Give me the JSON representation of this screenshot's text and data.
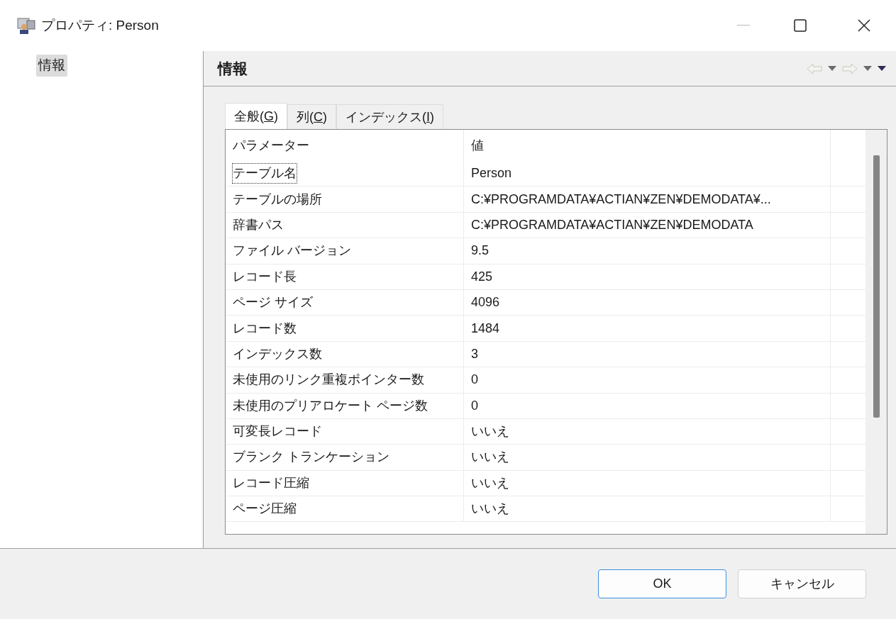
{
  "window": {
    "title": "プロパティ: Person"
  },
  "sidebar": {
    "items": [
      {
        "label": "情報",
        "selected": true
      }
    ]
  },
  "panel": {
    "title": "情報"
  },
  "tabs": [
    {
      "label": "全般(**G**)",
      "selected": true
    },
    {
      "label": "列(**C**)",
      "selected": false
    },
    {
      "label": "インデックス(**I**)",
      "selected": false
    }
  ],
  "table": {
    "columns": [
      "パラメーター",
      "値"
    ],
    "rows": [
      {
        "parameter": "テーブル名",
        "value": "Person",
        "focused": true
      },
      {
        "parameter": "テーブルの場所",
        "value": "C:¥PROGRAMDATA¥ACTIAN¥ZEN¥DEMODATA¥...",
        "focused": false
      },
      {
        "parameter": "辞書パス",
        "value": "C:¥PROGRAMDATA¥ACTIAN¥ZEN¥DEMODATA",
        "focused": false
      },
      {
        "parameter": "ファイル バージョン",
        "value": "9.5",
        "focused": false
      },
      {
        "parameter": "レコード長",
        "value": "425",
        "focused": false
      },
      {
        "parameter": "ページ サイズ",
        "value": "4096",
        "focused": false
      },
      {
        "parameter": "レコード数",
        "value": "1484",
        "focused": false
      },
      {
        "parameter": "インデックス数",
        "value": "3",
        "focused": false
      },
      {
        "parameter": "未使用のリンク重複ポインター数",
        "value": "0",
        "focused": false
      },
      {
        "parameter": "未使用のプリアロケート ページ数",
        "value": "0",
        "focused": false
      },
      {
        "parameter": "可変長レコード",
        "value": "いいえ",
        "focused": false
      },
      {
        "parameter": "ブランク トランケーション",
        "value": "いいえ",
        "focused": false
      },
      {
        "parameter": "レコード圧縮",
        "value": "いいえ",
        "focused": false
      },
      {
        "parameter": "ページ圧縮",
        "value": "いいえ",
        "focused": false
      }
    ]
  },
  "buttons": [
    {
      "label": "OK",
      "kind": "default"
    },
    {
      "label": "キャンセル",
      "kind": "normal"
    }
  ]
}
